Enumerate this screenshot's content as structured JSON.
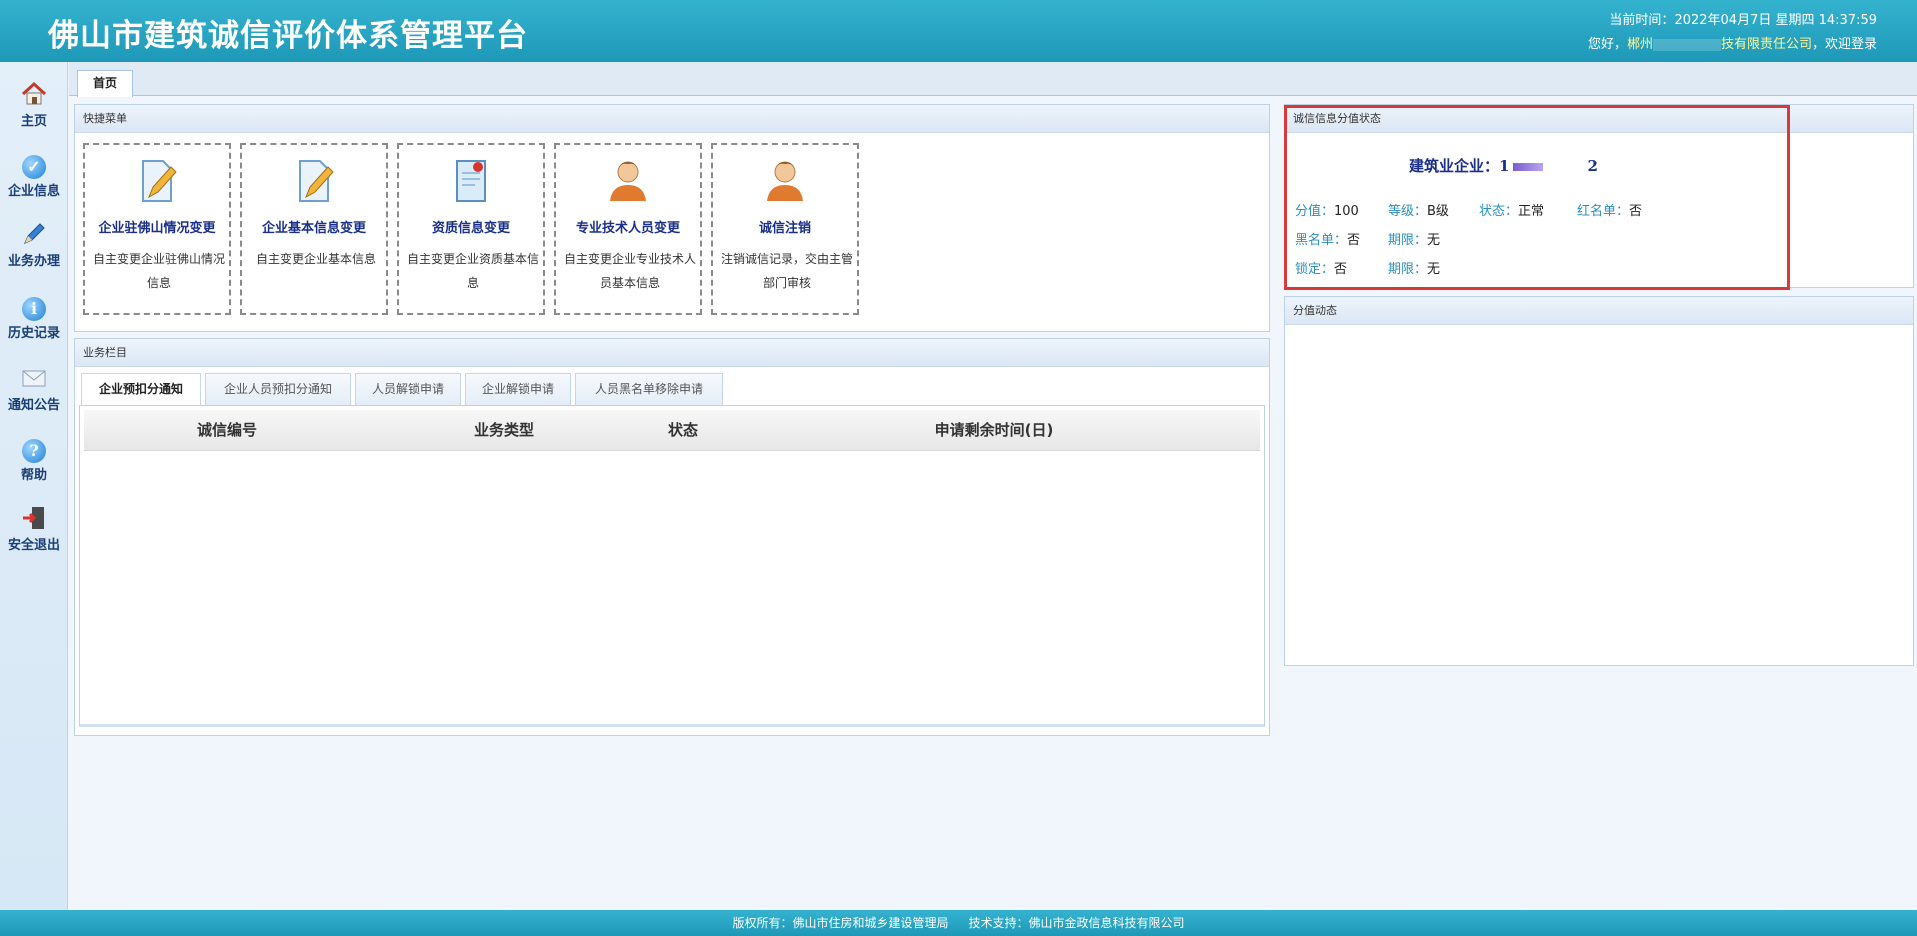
{
  "header": {
    "app_title": "佛山市建筑诚信评价体系管理平台",
    "time_label": "当前时间：",
    "time_value": "2022年04月7日 星期四 14:37:59",
    "greeting_prefix": "您好，",
    "company_part1": "郴州",
    "company_part2": "技有限责任公司",
    "greeting_suffix": "，欢迎登录"
  },
  "nav": {
    "items": [
      {
        "label": "主页",
        "icon": "home-icon"
      },
      {
        "label": "企业信息",
        "icon": "company-info-icon"
      },
      {
        "label": "业务办理",
        "icon": "pencil-icon"
      },
      {
        "label": "历史记录",
        "icon": "info-icon"
      },
      {
        "label": "通知公告",
        "icon": "mail-icon"
      },
      {
        "label": "帮助",
        "icon": "help-icon"
      },
      {
        "label": "安全退出",
        "icon": "logout-icon"
      }
    ]
  },
  "tabs": {
    "home": "首页"
  },
  "quick_menu": {
    "title": "快捷菜单",
    "cards": [
      {
        "title": "企业驻佛山情况变更",
        "desc": "自主变更企业驻佛山情况信息",
        "icon": "edit-document-icon"
      },
      {
        "title": "企业基本信息变更",
        "desc": "自主变更企业基本信息",
        "icon": "edit-document-icon"
      },
      {
        "title": "资质信息变更",
        "desc": "自主变更企业资质基本信息",
        "icon": "certificate-icon"
      },
      {
        "title": "专业技术人员变更",
        "desc": "自主变更企业专业技术人员基本信息",
        "icon": "user-icon"
      },
      {
        "title": "诚信注销",
        "desc": "注销诚信记录，交由主管部门审核",
        "icon": "user-icon"
      }
    ]
  },
  "business": {
    "title": "业务栏目",
    "tabs": [
      "企业预扣分通知",
      "企业人员预扣分通知",
      "人员解锁申请",
      "企业解锁申请",
      "人员黑名单移除申请"
    ],
    "active_tab": 0,
    "columns": [
      "诚信编号",
      "业务类型",
      "状态",
      "申请剩余时间(日)"
    ]
  },
  "status_panel": {
    "title": "诚信信息分值状态",
    "enterprise_label": "建筑业企业：",
    "enterprise_code_start": "1",
    "enterprise_code_end": "2",
    "score_label": "分值：",
    "score": "100",
    "level_label": "等级：",
    "level": "B级",
    "state_label": "状态：",
    "state": "正常",
    "redlist_label": "红名单：",
    "redlist": "否",
    "blacklist_label": "黑名单：",
    "blacklist": "否",
    "blacklist_period_label": "期限：",
    "blacklist_period": "无",
    "lock_label": "锁定：",
    "lock": "否",
    "lock_period_label": "期限：",
    "lock_period": "无"
  },
  "score_dynamics": {
    "title": "分值动态"
  },
  "footer": {
    "copyright": "版权所有：佛山市住房和城乡建设管理局",
    "support": "技术支持：佛山市金政信息科技有限公司"
  },
  "colors": {
    "header": "#1e98b7",
    "highlight_box": "#d83a3a",
    "card_title": "#1a2f8a"
  }
}
